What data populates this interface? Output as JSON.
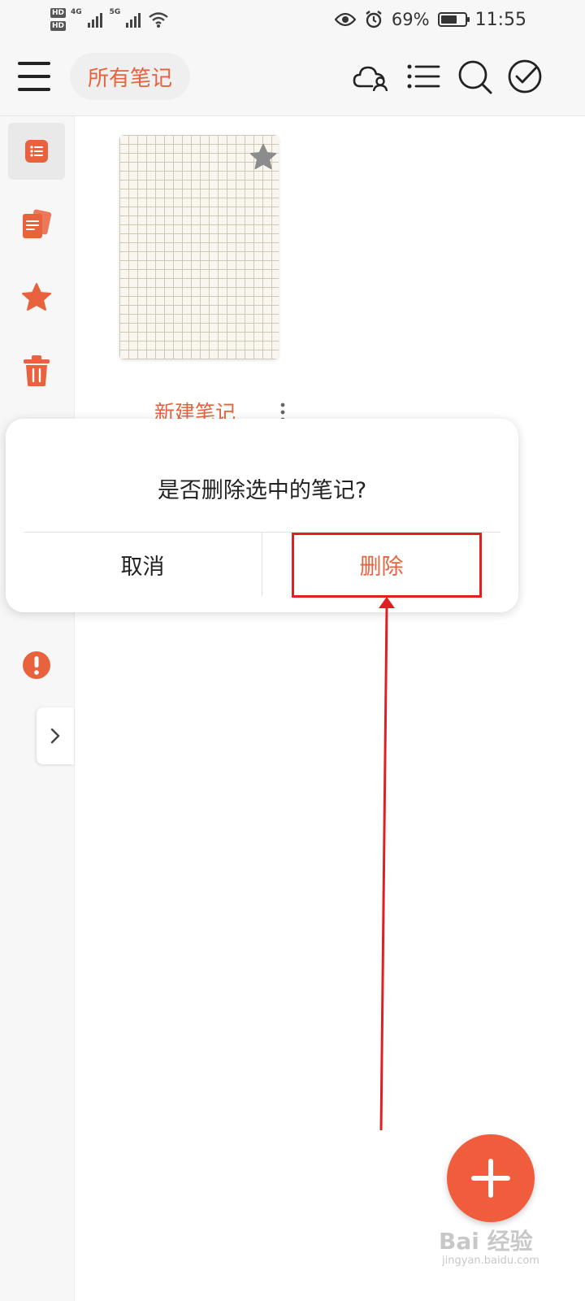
{
  "status_bar": {
    "hd1": "HD",
    "hd2": "HD",
    "net1": "4G",
    "net2": "5G",
    "battery_text": "69%",
    "battery_level": 0.69,
    "time": "11:55"
  },
  "header": {
    "folder_title": "所有笔记",
    "icons": [
      "cloud-user-icon",
      "list-icon",
      "search-icon",
      "check-circle-icon"
    ]
  },
  "sidebar": {
    "items": [
      {
        "icon": "notes-list-icon",
        "active": true
      },
      {
        "icon": "notebooks-icon",
        "active": false
      },
      {
        "icon": "star-icon",
        "active": false
      },
      {
        "icon": "trash-icon",
        "active": false
      },
      {
        "icon": "alert-icon",
        "active": false
      }
    ]
  },
  "note": {
    "title": "新建笔记"
  },
  "dialog": {
    "message": "是否删除选中的笔记?",
    "cancel_label": "取消",
    "delete_label": "删除"
  },
  "watermark": {
    "text": "Bai 经验",
    "sub": "jingyan.baidu.com"
  },
  "colors": {
    "accent": "#e8623d",
    "fab": "#ef5d3d",
    "annotation": "#e02020"
  }
}
